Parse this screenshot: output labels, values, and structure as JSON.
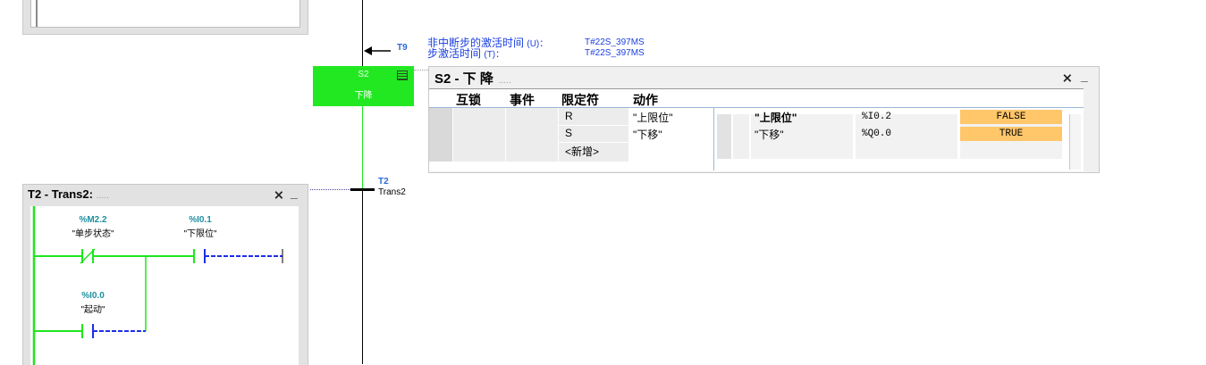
{
  "sfc": {
    "jump_target_label": "T9",
    "step": {
      "number": "S2",
      "name": "下降"
    },
    "activation_info": {
      "line1_label": "非中断步的激活时间",
      "line1_suffix": "(U)：",
      "line1_value": "T#22S_397MS",
      "line2_label": "步激活时间",
      "line2_suffix": "(T)：",
      "line2_value": "T#22S_397MS"
    },
    "transition": {
      "label": "T2",
      "name": "Trans2"
    }
  },
  "step_panel": {
    "title": "S2 - 下 降",
    "title_dots": ".....",
    "columns": [
      "互锁",
      "事件",
      "限定符",
      "动作"
    ],
    "rows": [
      {
        "qualifier": "R",
        "action": "\"上限位\"",
        "operand": "\"上限位\"",
        "address": "%I0.2",
        "status": "FALSE"
      },
      {
        "qualifier": "S",
        "action": "\"下移\"",
        "operand": "\"下移\"",
        "address": "%Q0.0",
        "status": "TRUE"
      },
      {
        "qualifier": "<新增>",
        "action": "",
        "operand": "",
        "address": "",
        "status": ""
      }
    ],
    "close_icon": "close-icon",
    "minimize_icon": "minimize-icon"
  },
  "trans_panel": {
    "title": "T2 - Trans2:",
    "title_dots": ".....",
    "contacts": [
      {
        "address": "%M2.2",
        "symbol": "\"单步状态\"",
        "type": "normally-closed"
      },
      {
        "address": "%I0.1",
        "symbol": "\"下限位\"",
        "type": "normally-open"
      },
      {
        "address": "%I0.0",
        "symbol": "\"起动\"",
        "type": "normally-open"
      }
    ]
  },
  "colors": {
    "active_green": "#22e822",
    "status_orange": "#ffc66a",
    "link_blue": "#1a3ee0"
  }
}
